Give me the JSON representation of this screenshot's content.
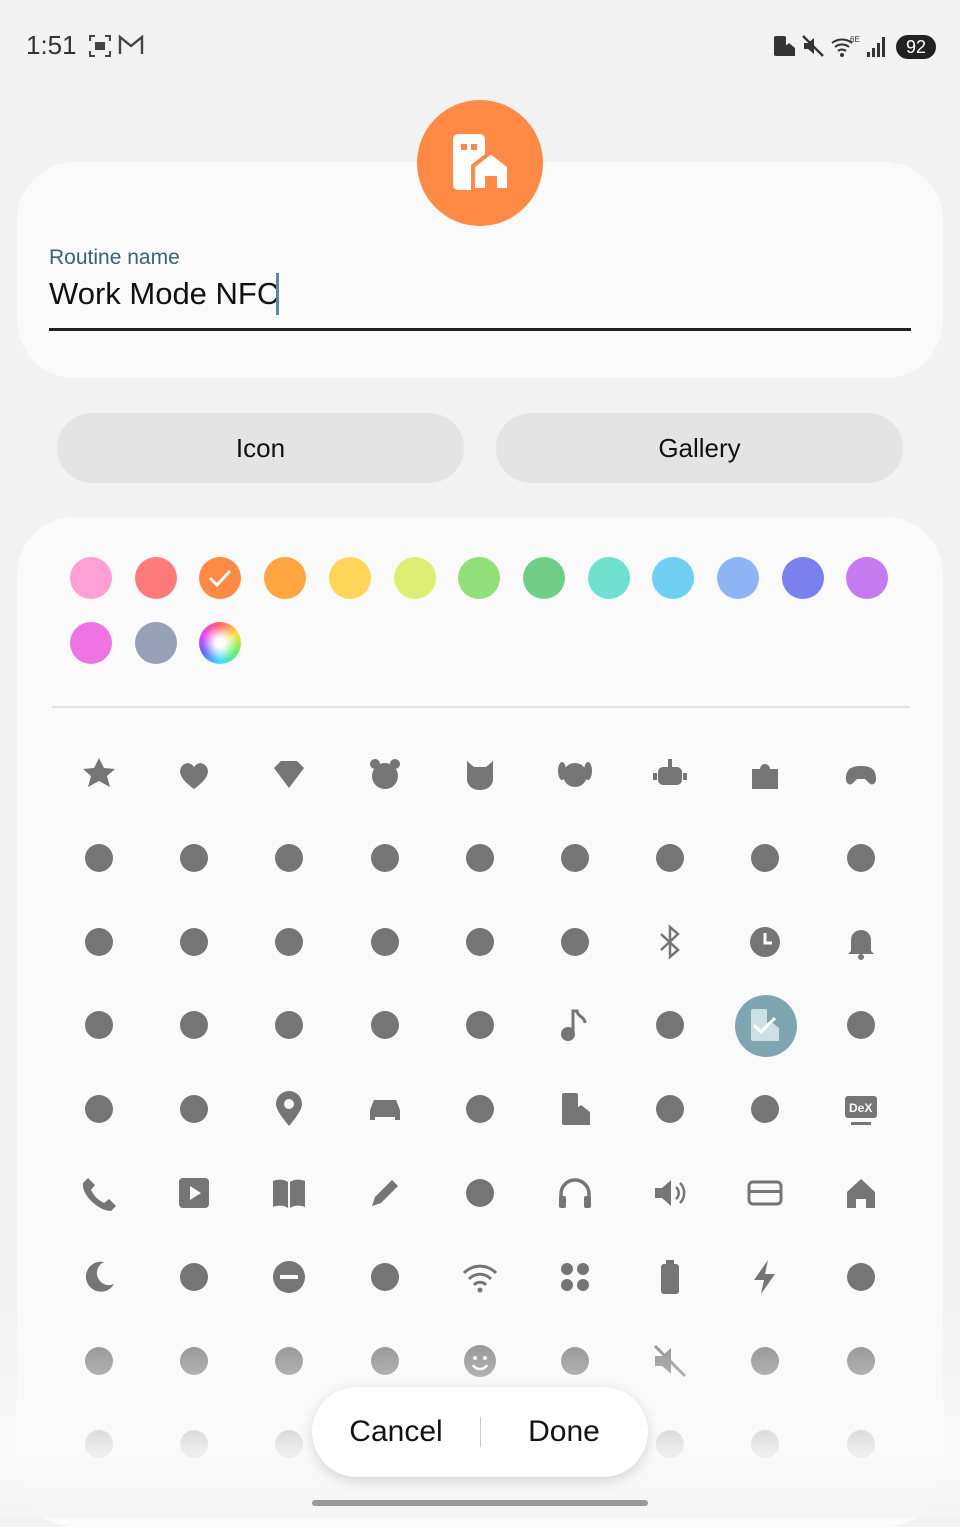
{
  "status_bar": {
    "time": "1:51",
    "battery": "92",
    "icons": [
      "screenshot-icon",
      "gmail-icon",
      "building-icon",
      "mute-icon",
      "wifi-6e-icon",
      "signal-icon"
    ]
  },
  "routine": {
    "icon_color": "#ff8a45",
    "name_label": "Routine name",
    "name_value": "Work Mode NFC"
  },
  "tabs": {
    "icon_label": "Icon",
    "gallery_label": "Gallery"
  },
  "colors": {
    "swatches": [
      "#ff9fd6",
      "#ff7b7b",
      "#ff8a45",
      "#ffa640",
      "#ffd65a",
      "#dcef74",
      "#92de78",
      "#6fcf86",
      "#6fe0cf",
      "#6fd0f2",
      "#8fb4f6",
      "#7b80ef",
      "#c57af0",
      "#f073e3",
      "#97a0b8",
      "rainbow"
    ],
    "selected": "#ff8a45"
  },
  "icons": {
    "rows": [
      [
        "star-icon",
        "heart-icon",
        "diamond-icon",
        "bear-icon",
        "cat-icon",
        "dog-icon",
        "robot-icon",
        "puzzle-icon",
        "gamepad-icon"
      ],
      [
        "bottles-icon",
        "flask-icon",
        "cart-icon",
        "leaf-icon",
        "baby-icon",
        "gift-icon",
        "cutlery-icon",
        "thumbs-up-icon",
        "chat-icon"
      ],
      [
        "alarm-icon",
        "calendar-icon",
        "bulb-icon",
        "cocktail-icon",
        "basketball-icon",
        "paw-icon",
        "bluetooth-icon",
        "clock-icon",
        "bell-icon"
      ],
      [
        "planet-icon",
        "ice-cream-icon",
        "watch-icon",
        "dashed-check-icon",
        "sunrise-icon",
        "music-note-icon",
        "network-icon",
        "office-home-icon",
        "shield-user-icon"
      ],
      [
        "person-route-icon",
        "home-enter-icon",
        "location-pin-icon",
        "car-icon",
        "quote-bubble-icon",
        "building-icon",
        "group-icon",
        "home-location-icon",
        "dex-icon"
      ],
      [
        "phone-icon",
        "play-icon",
        "book-icon",
        "pencil-icon",
        "sync-icon",
        "headphones-icon",
        "volume-icon",
        "card-icon",
        "house-icon"
      ],
      [
        "moon-icon",
        "bed-icon",
        "minus-circle-icon",
        "luggage-icon",
        "wifi-icon",
        "apps-icon",
        "battery-icon",
        "flash-icon",
        "clapper-icon"
      ],
      [
        "running-icon",
        "heart-rate-icon",
        "bicycle-icon",
        "sound-note-icon",
        "smiley-icon",
        "brightness-icon",
        "mute-icon",
        "hearing-icon",
        "qr-code-icon"
      ],
      [
        "flashlight-icon",
        "phone-device-icon",
        "tablet-icon",
        "",
        "",
        "",
        "lock-clock-icon",
        "battery-alert-icon",
        "scan-image-icon"
      ]
    ],
    "selected": "office-home-icon",
    "icon_color": "#757575"
  },
  "actions": {
    "cancel_label": "Cancel",
    "done_label": "Done"
  }
}
